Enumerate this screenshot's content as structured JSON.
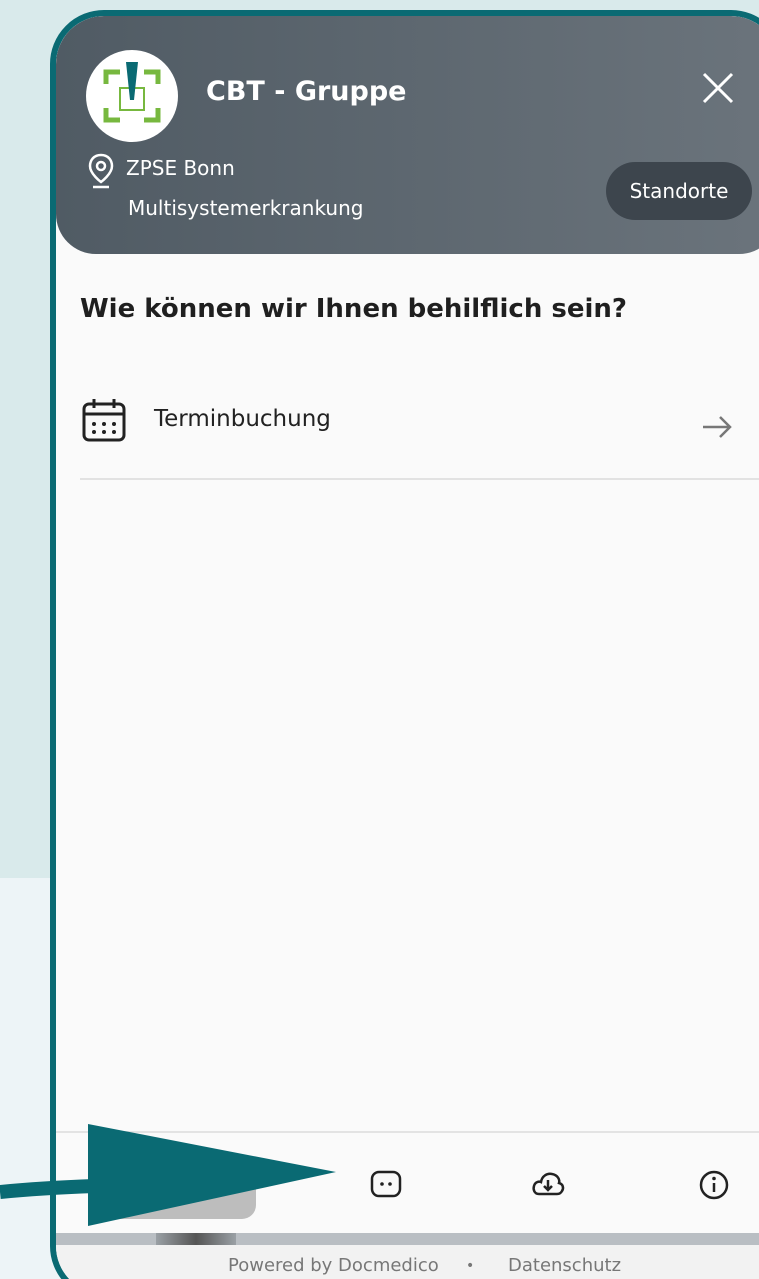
{
  "header": {
    "title": "CBT - Gruppe",
    "location_name": "ZPSE Bonn",
    "location_sub": "Multisystemerkrankung",
    "locations_button": "Standorte",
    "close_icon": "close-icon",
    "pin_icon": "location-pin-icon"
  },
  "main": {
    "question": "Wie können wir Ihnen behilflich sein?",
    "options": [
      {
        "label": "Terminbuchung",
        "icon": "calendar-icon",
        "trailing_icon": "arrow-right-icon"
      }
    ]
  },
  "bottom_nav": {
    "items": [
      {
        "icon": "chat-icon"
      },
      {
        "icon": "download-icon"
      },
      {
        "icon": "info-icon"
      }
    ]
  },
  "footer": {
    "powered_by": "Powered by Docmedico",
    "separator": "•",
    "privacy": "Datenschutz"
  },
  "colors": {
    "accent": "#0a6a73",
    "header_bg": "#5c666f",
    "page_bg": "#d9eaeb"
  }
}
